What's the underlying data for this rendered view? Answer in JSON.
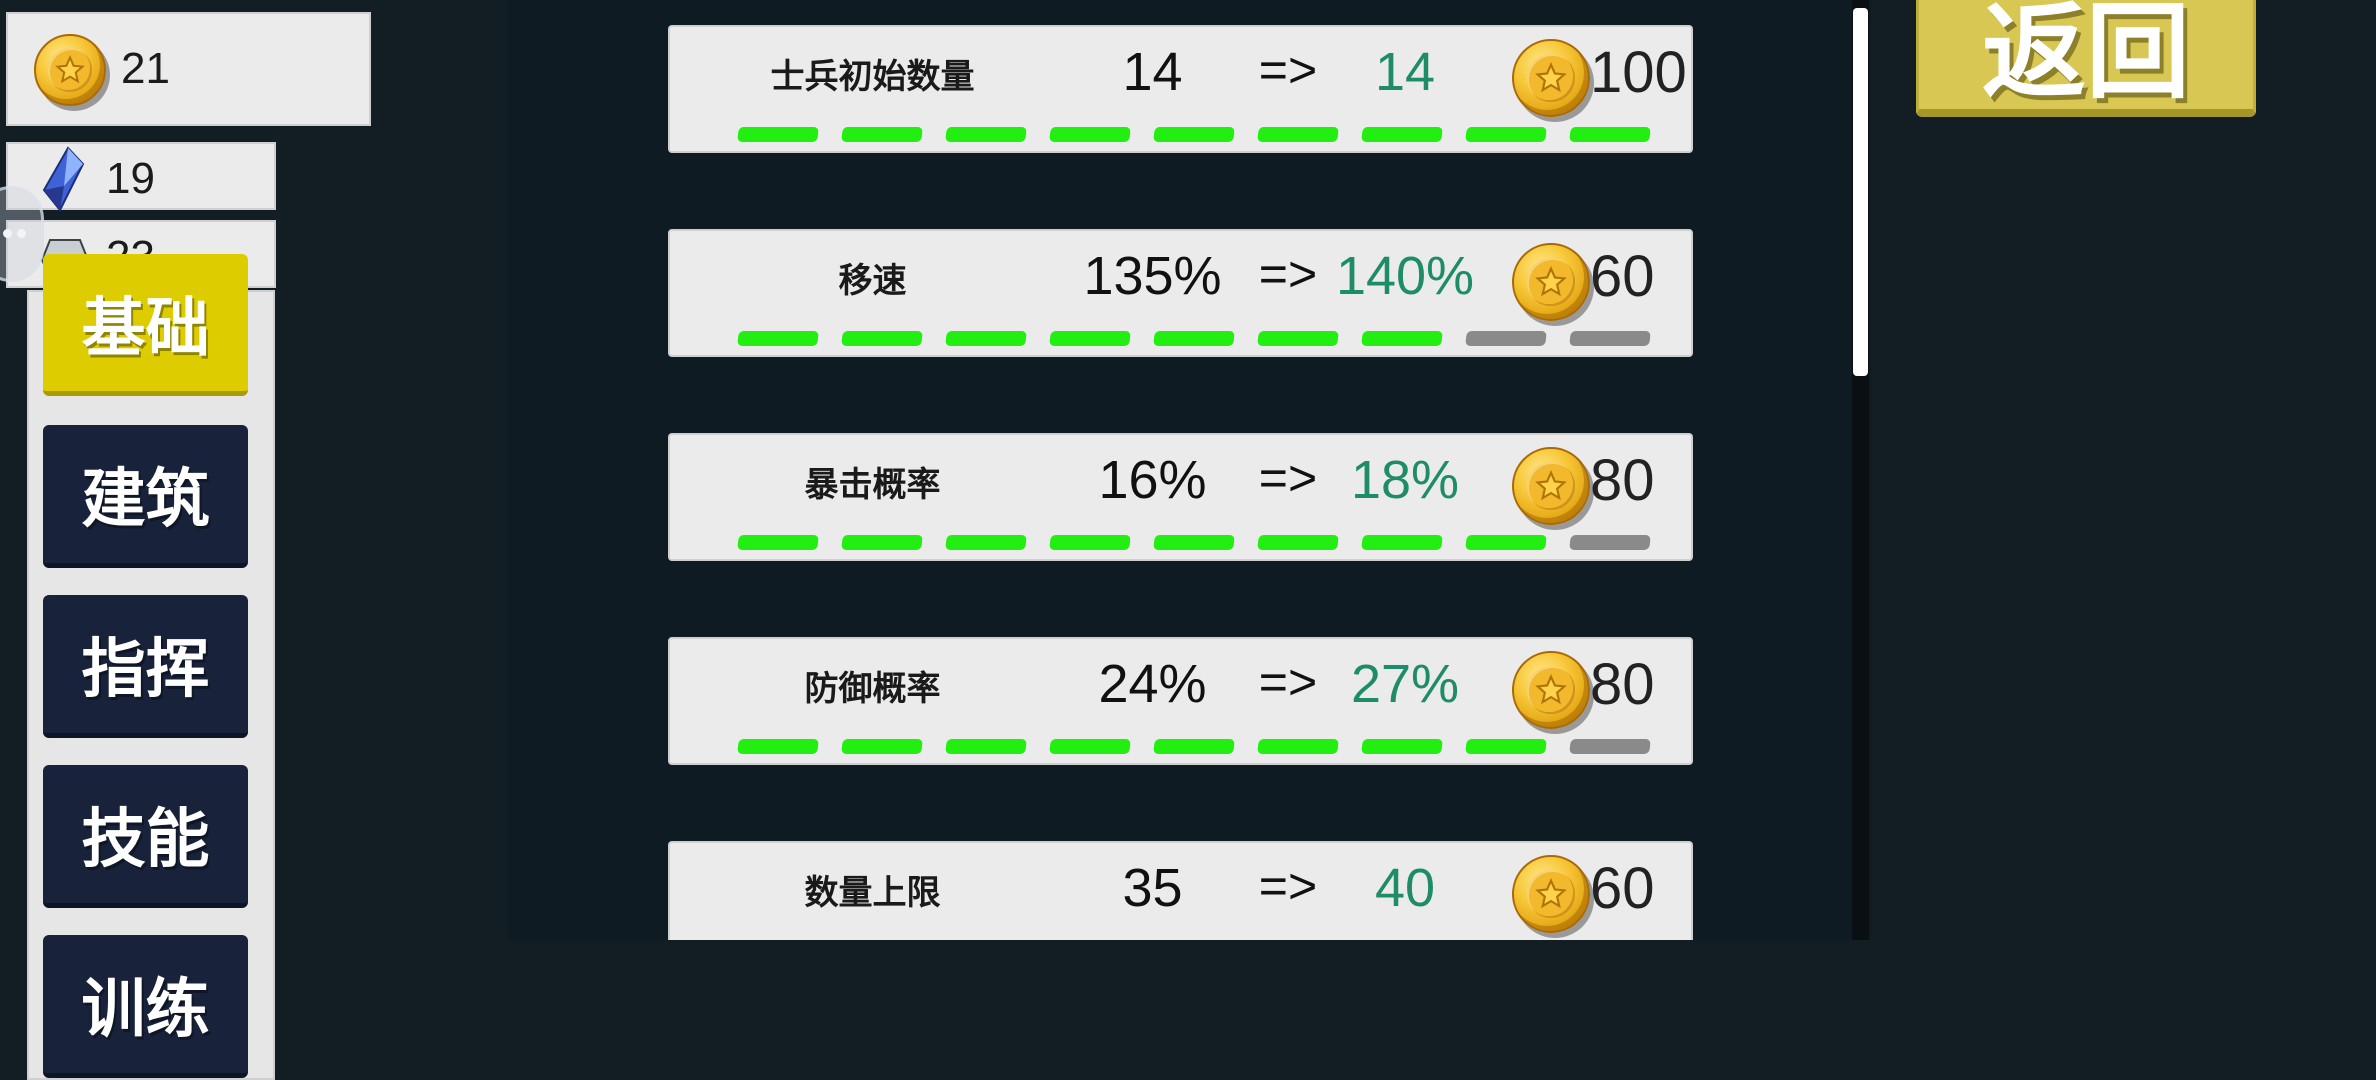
{
  "resources": {
    "gold": {
      "icon": "gold-coin-icon",
      "value": "21"
    },
    "crystal": {
      "icon": "blue-crystal-icon",
      "value": "19"
    },
    "iron": {
      "icon": "iron-ingot-icon",
      "value": "23"
    }
  },
  "sidebar": {
    "items": [
      {
        "label": "基础",
        "active": true
      },
      {
        "label": "建筑",
        "active": false
      },
      {
        "label": "指挥",
        "active": false
      },
      {
        "label": "技能",
        "active": false
      },
      {
        "label": "训练",
        "active": false
      }
    ]
  },
  "back_button": {
    "label": "返回"
  },
  "upgrades": [
    {
      "name": "士兵初始数量",
      "current": "14",
      "arrow": "=>",
      "next": "14",
      "cost": "100",
      "level": 9,
      "max_level": 9
    },
    {
      "name": "移速",
      "current": "135%",
      "arrow": "=>",
      "next": "140%",
      "cost": "60",
      "level": 7,
      "max_level": 9
    },
    {
      "name": "暴击概率",
      "current": "16%",
      "arrow": "=>",
      "next": "18%",
      "cost": "80",
      "level": 8,
      "max_level": 9
    },
    {
      "name": "防御概率",
      "current": "24%",
      "arrow": "=>",
      "next": "27%",
      "cost": "80",
      "level": 8,
      "max_level": 9
    },
    {
      "name": "数量上限",
      "current": "35",
      "arrow": "=>",
      "next": "40",
      "cost": "60"
    }
  ],
  "colors": {
    "background": "#121d24",
    "accent_yellow": "#ddcc00",
    "next_value_green": "#1e8c68",
    "pip_on": "#22ee11",
    "pip_off": "#8a8a8a"
  }
}
